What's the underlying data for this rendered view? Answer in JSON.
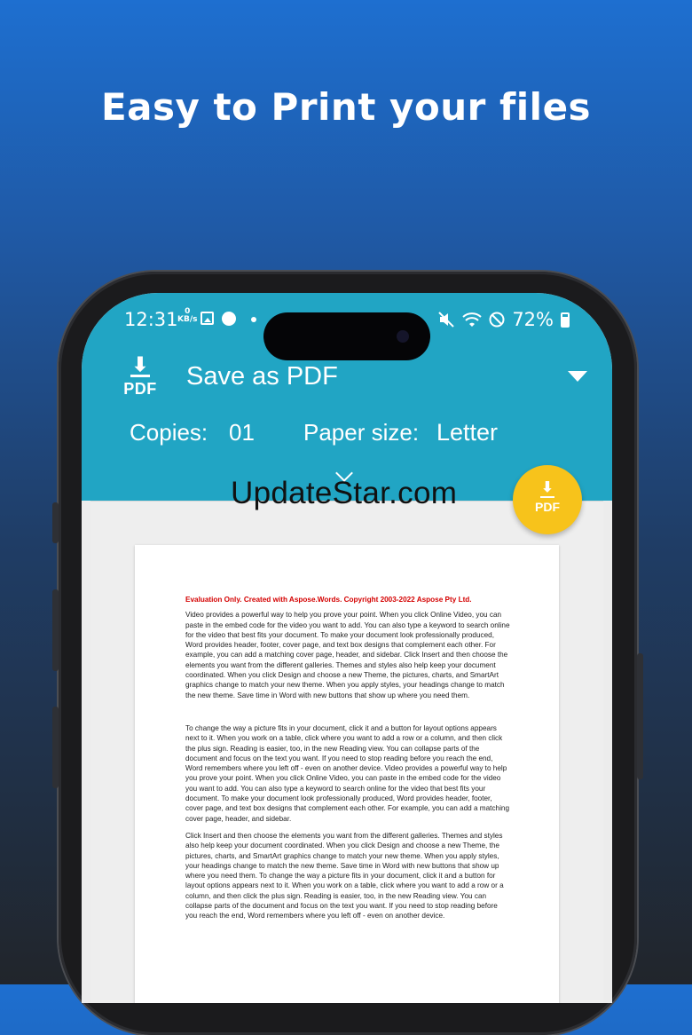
{
  "headline": "Easy to Print your files",
  "status_bar": {
    "time": "12:31",
    "kbs_value": "0",
    "kbs_unit": "KB/s",
    "battery": "72%"
  },
  "print_header": {
    "destination": "Save as PDF",
    "pdf_icon_label": "PDF",
    "copies_label": "Copies:",
    "copies_value": "01",
    "paper_size_label": "Paper size:",
    "paper_size_value": "Letter"
  },
  "watermark": "UpdateStar.com",
  "fab_label": "PDF",
  "document": {
    "evaluation_notice": "Evaluation Only. Created with Aspose.Words. Copyright 2003-2022 Aspose Pty Ltd.",
    "paragraphs": [
      "Video provides a powerful way to help you prove your point. When you click Online Video, you can paste in the embed code for the video you want to add. You can also type a keyword to search online for the video that best fits your document. To make your document look professionally produced, Word provides header, footer, cover page, and text box designs that complement each other. For example, you can add a matching cover page, header, and sidebar. Click Insert and then choose the elements you want from the different galleries. Themes and styles also help keep your document coordinated. When you click Design and choose a new Theme, the pictures, charts, and SmartArt graphics change to match your new theme. When you apply styles, your headings change to match the new theme. Save time in Word with new buttons that show up where you need them.",
      "To change the way a picture fits in your document, click it and a button for layout options appears next to it. When you work on a table, click where you want to add a row or a column, and then click the plus sign. Reading is easier, too, in the new Reading view. You can collapse parts of the document and focus on the text you want. If you need to stop reading before you reach the end, Word remembers where you left off - even on another device. Video provides a powerful way to help you prove your point. When you click Online Video, you can paste in the embed code for the video you want to add. You can also type a keyword to search online for the video that best fits your document. To make your document look professionally produced, Word provides header, footer, cover page, and text box designs that complement each other. For example, you can add a matching cover page, header, and sidebar.",
      "Click Insert and then choose the elements you want from the different galleries. Themes and styles also help keep your document coordinated. When you click Design and choose a new Theme, the pictures, charts, and SmartArt graphics change to match your new theme. When you apply styles, your headings change to match the new theme. Save time in Word with new buttons that show up where you need them. To change the way a picture fits in your document, click it and a button for layout options appears next to it. When you work on a table, click where you want to add a row or a column, and then click the plus sign. Reading is easier, too, in the new Reading view. You can collapse parts of the document and focus on the text you want. If you need to stop reading before you reach the end, Word remembers where you left off - even on another device."
    ]
  },
  "colors": {
    "app_bar": "#21a5c4",
    "fab": "#f7c31b",
    "evaluation_text": "#d40000"
  }
}
